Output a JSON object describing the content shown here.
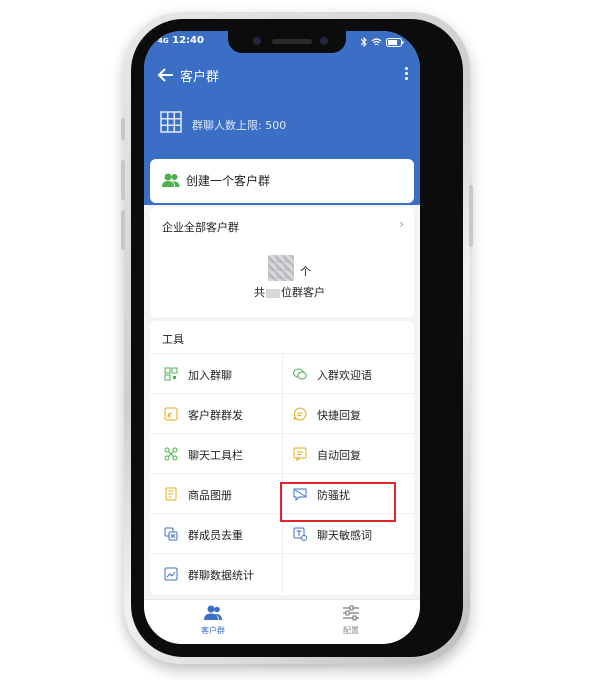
{
  "status_bar": {
    "time": "12:40",
    "signal": "4G"
  },
  "header": {
    "title": "客户群",
    "limit_text": "群聊人数上限: 500"
  },
  "create_group": {
    "label": "创建一个客户群"
  },
  "all_groups": {
    "title": "企业全部客户群",
    "count_unit": "个",
    "summary_prefix": "共",
    "summary_suffix": "位群客户"
  },
  "tools": {
    "title": "工具",
    "items": [
      {
        "label": "加入群聊",
        "icon": "qr-code-icon",
        "color": "#4caf50"
      },
      {
        "label": "入群欢迎语",
        "icon": "chat-bubbles-icon",
        "color": "#4caf50"
      },
      {
        "label": "客户群群发",
        "icon": "broadcast-icon",
        "color": "#e6a817"
      },
      {
        "label": "快捷回复",
        "icon": "quick-reply-icon",
        "color": "#e6a817"
      },
      {
        "label": "聊天工具栏",
        "icon": "toolbar-icon",
        "color": "#4caf50"
      },
      {
        "label": "自动回复",
        "icon": "auto-reply-icon",
        "color": "#e6a817"
      },
      {
        "label": "商品图册",
        "icon": "catalog-icon",
        "color": "#e6a817"
      },
      {
        "label": "防骚扰",
        "icon": "shield-message-icon",
        "color": "#3b6fc6"
      },
      {
        "label": "群成员去重",
        "icon": "member-dedupe-icon",
        "color": "#3b6fc6"
      },
      {
        "label": "聊天敏感词",
        "icon": "sensitive-word-icon",
        "color": "#3b6fc6"
      },
      {
        "label": "群聊数据统计",
        "icon": "stats-chart-icon",
        "color": "#3b6fc6"
      }
    ]
  },
  "tab_bar": {
    "tabs": [
      {
        "label": "客户群",
        "icon": "people-icon",
        "active": true
      },
      {
        "label": "配置",
        "icon": "settings-sliders-icon",
        "active": false
      }
    ]
  },
  "colors": {
    "brand_blue": "#3b6fc6",
    "highlight_red": "#e0252b"
  }
}
